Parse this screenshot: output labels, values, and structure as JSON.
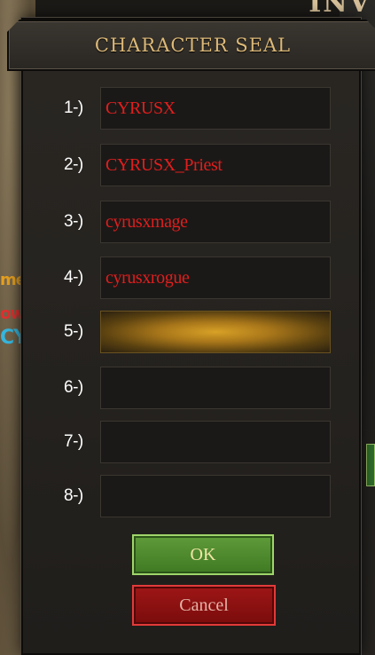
{
  "background": {
    "window_title_fragment": "INV",
    "left_fragments": [
      "me",
      "ow",
      "CY"
    ]
  },
  "dialog": {
    "title": "CHARACTER SEAL",
    "slots": [
      {
        "label": "1-)",
        "name": "CYRUSX",
        "selected": false
      },
      {
        "label": "2-)",
        "name": "CYRUSX_Priest",
        "selected": false
      },
      {
        "label": "3-)",
        "name": "cyrusxmage",
        "selected": false
      },
      {
        "label": "4-)",
        "name": "cyrusxrogue",
        "selected": false
      },
      {
        "label": "5-)",
        "name": "",
        "selected": true
      },
      {
        "label": "6-)",
        "name": "",
        "selected": false
      },
      {
        "label": "7-)",
        "name": "",
        "selected": false
      },
      {
        "label": "8-)",
        "name": "",
        "selected": false
      }
    ],
    "ok_label": "OK",
    "cancel_label": "Cancel"
  },
  "colors": {
    "title": "#dcb978",
    "character_name": "#e01e1e",
    "selected_slot": "#d8a126",
    "ok_button": "#4f8a2e",
    "cancel_button": "#8e1212"
  }
}
